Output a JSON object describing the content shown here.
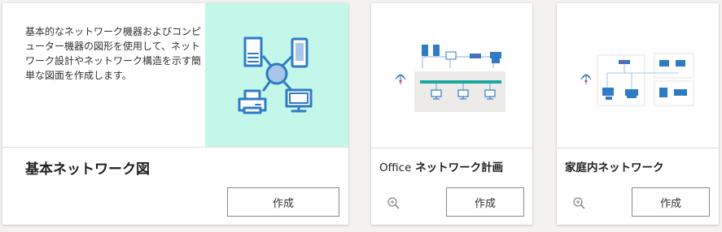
{
  "templates": [
    {
      "title": "基本ネットワーク図",
      "description": "基本的なネットワーク機器およびコンピューター機器の図形を使用して、ネットワーク設計やネットワーク構造を示す簡単な図面を作成します。",
      "create_label": "作成",
      "accent": "#c2f7ea"
    },
    {
      "title_prefix": "Office",
      "title_suffix": " ネットワーク計画",
      "create_label": "作成"
    },
    {
      "title": "家庭内ネットワーク",
      "create_label": "作成"
    }
  ],
  "colors": {
    "icon_blue": "#2f7bc4",
    "hub_fill": "#a8c7e8",
    "teal_bar": "#1aa7a0"
  }
}
